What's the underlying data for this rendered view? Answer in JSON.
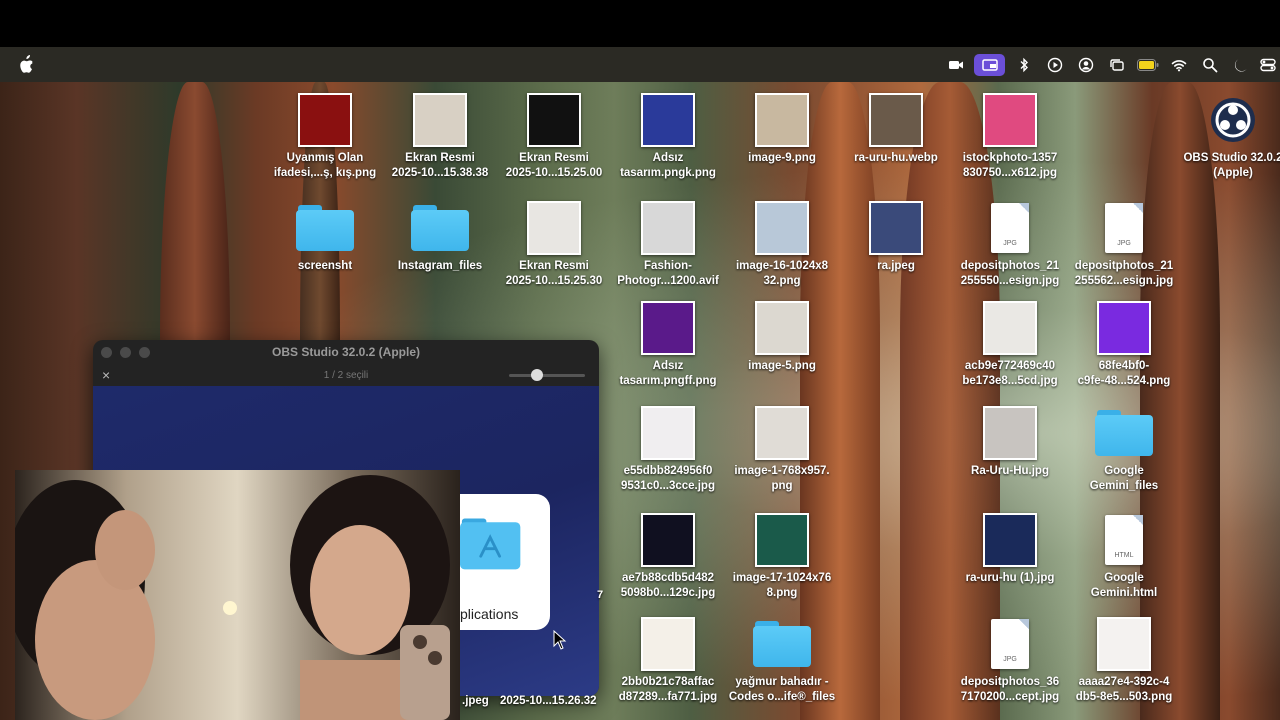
{
  "menubar": {
    "apple_icon": "apple-logo",
    "tray_icons": [
      "video-camera-icon",
      "screen-mirroring-icon",
      "bluetooth-icon",
      "play-circle-icon",
      "user-circle-icon",
      "window-stack-icon",
      "battery-icon",
      "wifi-icon",
      "search-icon",
      "moon-icon",
      "control-center-icon"
    ],
    "active_color": "#6b4fd8"
  },
  "desktop": {
    "icons": [
      {
        "label": "Uyanmış Olan\nifadesi,...ş, kış.png",
        "kind": "image",
        "color": "#8a1010"
      },
      {
        "label": "Ekran Resmi\n2025-10...15.38.38",
        "kind": "image",
        "color": "#d8d0c4"
      },
      {
        "label": "Ekran Resmi\n2025-10...15.25.00",
        "kind": "image",
        "color": "#111111"
      },
      {
        "label": "Adsız\ntasarım.pngk.png",
        "kind": "image",
        "color": "#2a3a9a"
      },
      {
        "label": "image-9.png",
        "kind": "image",
        "color": "#c8b8a0"
      },
      {
        "label": "ra-uru-hu.webp",
        "kind": "image",
        "color": "#6a5a4a"
      },
      {
        "label": "istockphoto-1357\n830750...x612.jpg",
        "kind": "image",
        "color": "#e04a80"
      },
      {
        "label": "OBS Studio 32.0.2\n(Apple)",
        "kind": "app",
        "color": "#1e2d4d"
      },
      {
        "label": "screensht",
        "kind": "folder"
      },
      {
        "label": "Instagram_files",
        "kind": "folder"
      },
      {
        "label": "Ekran Resmi\n2025-10...15.25.30",
        "kind": "image",
        "color": "#e8e6e2"
      },
      {
        "label": "Fashion-\nPhotogr...1200.avif",
        "kind": "image",
        "color": "#d8d8d8"
      },
      {
        "label": "image-16-1024x8\n32.png",
        "kind": "image",
        "color": "#b8c8d8"
      },
      {
        "label": "ra.jpeg",
        "kind": "image",
        "color": "#3a4a7a"
      },
      {
        "label": "depositphotos_21\n255550...esign.jpg",
        "kind": "jpg",
        "ext": "JPG"
      },
      {
        "label": "depositphotos_21\n255562...esign.jpg",
        "kind": "jpg",
        "ext": "JPG"
      },
      {
        "label": "Adsız\ntasarım.pngff.png",
        "kind": "image",
        "color": "#5a1a8a"
      },
      {
        "label": "image-5.png",
        "kind": "image",
        "color": "#dcd8d0"
      },
      {
        "label": "acb9e772469c40\nbe173e8...5cd.jpg",
        "kind": "image",
        "color": "#eae8e4"
      },
      {
        "label": "68fe4bf0-\nc9fe-48...524.png",
        "kind": "image",
        "color": "#7a2ae0"
      },
      {
        "label": "e55dbb824956f0\n9531c0...3cce.jpg",
        "kind": "image",
        "color": "#f0eef0"
      },
      {
        "label": "image-1-768x957.\npng",
        "kind": "image",
        "color": "#e0dcd6"
      },
      {
        "label": "Ra-Uru-Hu.jpg",
        "kind": "image",
        "color": "#c8c4c0"
      },
      {
        "label": "Google\nGemini_files",
        "kind": "folder"
      },
      {
        "label": "ae7b88cdb5d482\n5098b0...129c.jpg",
        "kind": "image",
        "color": "#101020"
      },
      {
        "label": "image-17-1024x76\n8.png",
        "kind": "image",
        "color": "#1a5a4a"
      },
      {
        "label": "ra-uru-hu (1).jpg",
        "kind": "image",
        "color": "#1a2a5a"
      },
      {
        "label": "Google\nGemini.html",
        "kind": "html",
        "ext": "HTML"
      },
      {
        "label": "2bb0b21c78affac\nd87289...fa771.jpg",
        "kind": "image",
        "color": "#f4f0e8"
      },
      {
        "label": "yağmur bahadır -\nCodes o...ife®_files",
        "kind": "folder"
      },
      {
        "label": "depositphotos_36\n7170200...cept.jpg",
        "kind": "jpg",
        "ext": "JPG"
      },
      {
        "label": "aaaa27e4-392c-4\ndb5-8e5...503.png",
        "kind": "image",
        "color": "#f4f2f0"
      }
    ],
    "partial_labels": {
      "left_jpeg": ".jpeg",
      "left_time": "2025-10...15.26.32",
      "digit": "7"
    }
  },
  "obs_window": {
    "title": "OBS Studio 32.0.2 (Apple)",
    "subtitle": "1 / 2 seçili",
    "close_glyph": "×",
    "preview_label": "plications"
  }
}
